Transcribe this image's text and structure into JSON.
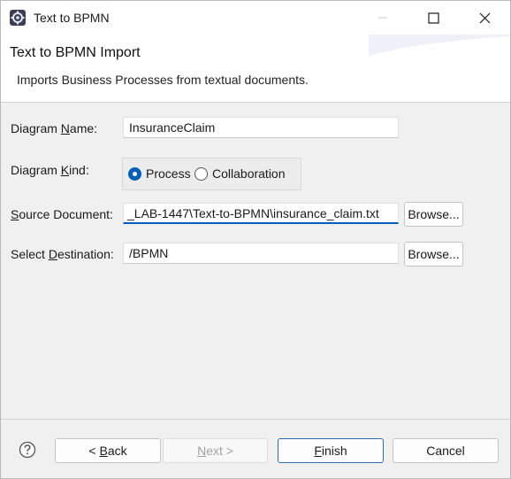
{
  "window": {
    "title": "Text to BPMN",
    "icon": "gear-diagram-icon",
    "controls": [
      "minimize-icon",
      "maximize-icon",
      "close-icon"
    ]
  },
  "header": {
    "title": "Text to BPMN Import",
    "description": "Imports Business Processes from textual documents."
  },
  "form": {
    "diagram_name": {
      "label_pre": "Diagram ",
      "label_mnemonic": "N",
      "label_post": "ame:",
      "value": "InsuranceClaim"
    },
    "diagram_kind": {
      "label_pre": "Diagram ",
      "label_mnemonic": "K",
      "label_post": "ind:",
      "options": [
        {
          "label": "Process",
          "selected": true
        },
        {
          "label": "Collaboration",
          "selected": false
        }
      ]
    },
    "source_document": {
      "label_pre": "",
      "label_mnemonic": "S",
      "label_post": "ource Document:",
      "value": "_LAB-1447\\Text-to-BPMN\\insurance_claim.txt",
      "browse_label": "Browse..."
    },
    "destination": {
      "label_pre": "Select ",
      "label_mnemonic": "D",
      "label_post": "estination:",
      "value": "/BPMN",
      "browse_label": "Browse..."
    }
  },
  "footer": {
    "help_icon": "help-icon",
    "back": {
      "pre": "< ",
      "mnemonic": "B",
      "post": "ack"
    },
    "next": {
      "pre": "",
      "mnemonic": "N",
      "post": "ext >"
    },
    "finish": {
      "pre": "",
      "mnemonic": "F",
      "post": "inish"
    },
    "cancel": "Cancel"
  },
  "colors": {
    "accent": "#005fb8",
    "background": "#f0f0f0"
  }
}
